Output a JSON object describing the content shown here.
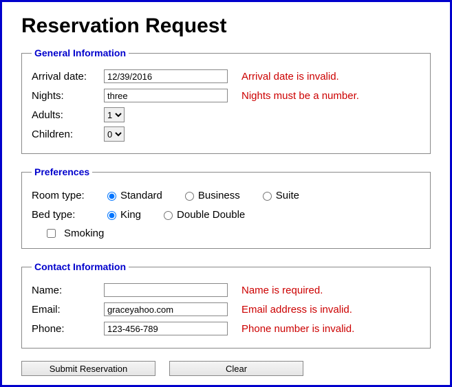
{
  "title": "Reservation Request",
  "general": {
    "legend": "General Information",
    "arrival_label": "Arrival date:",
    "arrival_value": "12/39/2016",
    "arrival_error": "Arrival date is invalid.",
    "nights_label": "Nights:",
    "nights_value": "three",
    "nights_error": "Nights must be a number.",
    "adults_label": "Adults:",
    "adults_value": "1",
    "children_label": "Children:",
    "children_value": "0"
  },
  "preferences": {
    "legend": "Preferences",
    "roomtype_label": "Room type:",
    "room_standard": "Standard",
    "room_business": "Business",
    "room_suite": "Suite",
    "bedtype_label": "Bed type:",
    "bed_king": "King",
    "bed_double": "Double Double",
    "smoking_label": "Smoking"
  },
  "contact": {
    "legend": "Contact Information",
    "name_label": "Name:",
    "name_value": "",
    "name_error": "Name is required.",
    "email_label": "Email:",
    "email_value": "graceyahoo.com",
    "email_error": "Email address is invalid.",
    "phone_label": "Phone:",
    "phone_value": "123-456-789",
    "phone_error": "Phone number is invalid."
  },
  "buttons": {
    "submit": "Submit Reservation",
    "clear": "Clear"
  }
}
